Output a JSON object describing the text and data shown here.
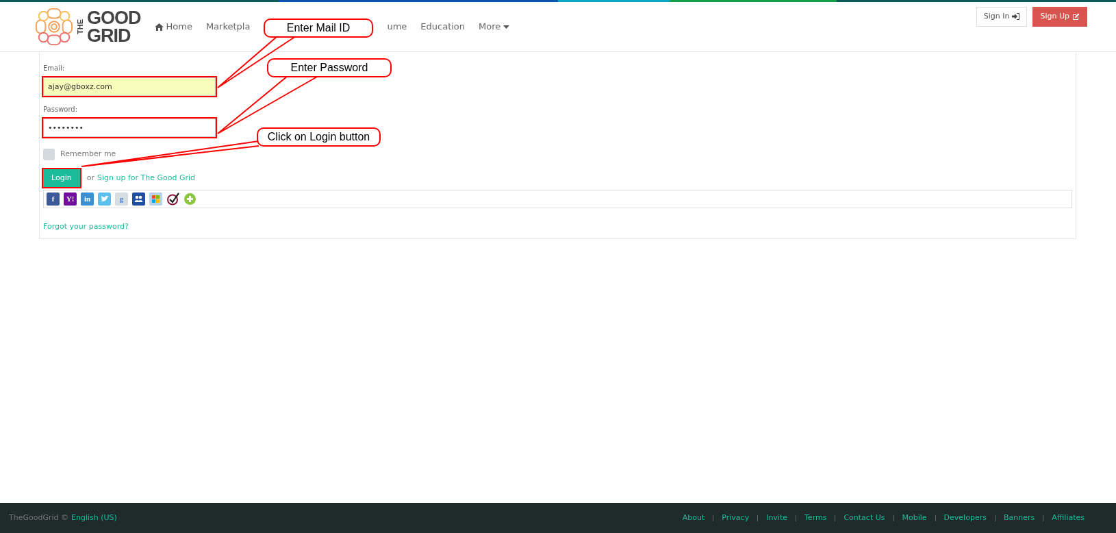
{
  "logo": {
    "small": "THE",
    "line1": "GOOD",
    "line2": "GRID"
  },
  "nav": [
    {
      "label": "Home",
      "kind": "home"
    },
    {
      "label": "Marketpla",
      "kind": "plain"
    },
    {
      "label": "ume",
      "kind": "plain"
    },
    {
      "label": "Education",
      "kind": "plain"
    },
    {
      "label": "More",
      "kind": "dropdown"
    }
  ],
  "auth_buttons": [
    {
      "label": "Sign In",
      "kind": "signin"
    },
    {
      "label": "Sign Up",
      "kind": "signup"
    }
  ],
  "form": {
    "email": {
      "label": "Email:",
      "value": "ajay@gboxz.com",
      "autofilled": true,
      "highlighted": true
    },
    "password": {
      "label": "Password:",
      "value": "••••••••",
      "autofilled": false,
      "highlighted": true
    },
    "remember": {
      "label": "Remember me",
      "checked": false
    },
    "login": {
      "label": "Login",
      "highlighted": true
    },
    "or_text": "or",
    "signup_link": "Sign up for The Good Grid",
    "forgot_link": "Forgot your password?"
  },
  "social_icons": [
    {
      "kind": "letter",
      "glyph": "f",
      "color": "#3b5998"
    },
    {
      "kind": "letter",
      "glyph": "Y!",
      "color": "#720e9e"
    },
    {
      "kind": "letter",
      "glyph": "in",
      "color": "#3d8fcf"
    },
    {
      "kind": "bird",
      "color": "#5bc0eb"
    },
    {
      "kind": "letter",
      "glyph": "g",
      "color": "#d8dde2"
    },
    {
      "kind": "people",
      "color": "#1f4fa0"
    },
    {
      "kind": "window",
      "color": "#b9d3ea"
    },
    {
      "kind": "check",
      "color": "#8a1538"
    },
    {
      "kind": "plus",
      "color": "#8cc63f"
    }
  ],
  "callouts": [
    {
      "text": "Enter Mail ID"
    },
    {
      "text": "Enter Password"
    },
    {
      "text": "Click on Login button"
    }
  ],
  "footer": {
    "brand": "TheGoodGrid ©",
    "language": "English (US)",
    "links": [
      "About",
      "Privacy",
      "Invite",
      "Terms",
      "Contact Us",
      "Mobile",
      "Developers",
      "Banners",
      "Affiliates"
    ]
  }
}
